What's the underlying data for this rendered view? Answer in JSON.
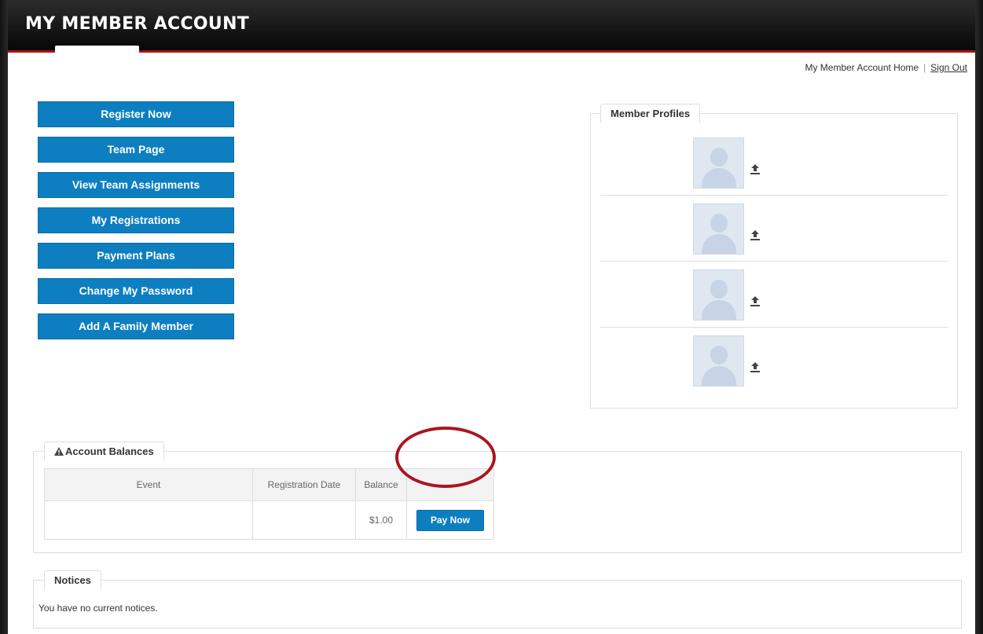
{
  "header": {
    "title": "MY MEMBER ACCOUNT"
  },
  "toplinks": {
    "home": "My Member Account Home",
    "separator": "|",
    "sign_out": "Sign Out"
  },
  "menu": [
    {
      "label": "Register Now"
    },
    {
      "label": "Team Page"
    },
    {
      "label": "View Team Assignments"
    },
    {
      "label": "My Registrations"
    },
    {
      "label": "Payment Plans"
    },
    {
      "label": "Change My Password"
    },
    {
      "label": "Add A Family Member"
    }
  ],
  "profiles": {
    "legend": "Member Profiles",
    "count": 4,
    "upload_icon": "upload-icon",
    "avatar_icon": "user-silhouette"
  },
  "balances": {
    "legend": "Account Balances",
    "legend_icon": "warning-icon",
    "columns": [
      "Event",
      "Registration Date",
      "Balance",
      ""
    ],
    "rows": [
      {
        "event": "",
        "registration_date": "",
        "balance": "$1.00",
        "action": "Pay Now"
      }
    ]
  },
  "notices": {
    "legend": "Notices",
    "text": "You have no current notices."
  },
  "colors": {
    "primary_button": "#0d7fc1",
    "header_accent": "#a8141b",
    "highlight_circle": "#a9161f"
  }
}
